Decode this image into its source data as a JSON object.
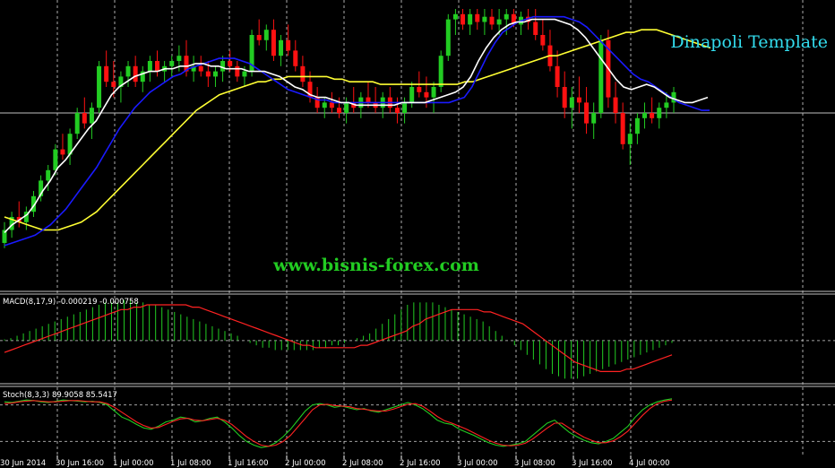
{
  "chart_data": {
    "type": "candlestick",
    "title": "Dinapoli Template",
    "watermark": "www.bisnis-forex.com",
    "colors": {
      "background": "#000000",
      "bull": "#22cc22",
      "bear": "#ff1111",
      "ma_white": "#ffffff",
      "ma_blue": "#1a1aff",
      "ma_yellow": "#ffff33",
      "macd_hist": "#22cc22",
      "macd_signal": "#ff2222",
      "stoch_main": "#22cc22",
      "stoch_signal": "#ff2222",
      "title": "#33ddee",
      "watermark": "#22cc22",
      "grid": "#cccccc"
    },
    "x_ticks": [
      "30 Jun 2014",
      "30 Jun 16:00",
      "1 Jul 00:00",
      "1 Jul 08:00",
      "1 Jul 16:00",
      "2 Jul 00:00",
      "2 Jul 08:00",
      "2 Jul 16:00",
      "3 Jul 00:00",
      "3 Jul 08:00",
      "3 Jul 16:00",
      "4 Jul 00:00"
    ],
    "price_range": [
      0,
      100
    ],
    "candles": [
      [
        10,
        18,
        8,
        15
      ],
      [
        15,
        22,
        12,
        20
      ],
      [
        20,
        26,
        16,
        18
      ],
      [
        18,
        24,
        15,
        22
      ],
      [
        22,
        30,
        20,
        28
      ],
      [
        28,
        36,
        26,
        34
      ],
      [
        34,
        40,
        30,
        38
      ],
      [
        38,
        48,
        36,
        46
      ],
      [
        46,
        52,
        42,
        44
      ],
      [
        44,
        54,
        40,
        52
      ],
      [
        52,
        62,
        50,
        60
      ],
      [
        60,
        66,
        54,
        56
      ],
      [
        56,
        64,
        50,
        62
      ],
      [
        62,
        80,
        60,
        78
      ],
      [
        78,
        84,
        70,
        72
      ],
      [
        72,
        80,
        66,
        70
      ],
      [
        70,
        76,
        64,
        74
      ],
      [
        74,
        80,
        70,
        78
      ],
      [
        78,
        82,
        70,
        72
      ],
      [
        72,
        78,
        68,
        76
      ],
      [
        76,
        82,
        72,
        80
      ],
      [
        80,
        84,
        74,
        76
      ],
      [
        76,
        80,
        72,
        78
      ],
      [
        78,
        82,
        74,
        80
      ],
      [
        80,
        86,
        76,
        82
      ],
      [
        82,
        88,
        74,
        76
      ],
      [
        76,
        82,
        72,
        78
      ],
      [
        78,
        82,
        74,
        76
      ],
      [
        76,
        80,
        70,
        74
      ],
      [
        74,
        78,
        70,
        76
      ],
      [
        76,
        82,
        72,
        80
      ],
      [
        80,
        84,
        76,
        78
      ],
      [
        78,
        80,
        72,
        74
      ],
      [
        74,
        78,
        70,
        76
      ],
      [
        76,
        92,
        74,
        90
      ],
      [
        90,
        96,
        86,
        88
      ],
      [
        88,
        94,
        84,
        92
      ],
      [
        92,
        96,
        80,
        82
      ],
      [
        82,
        90,
        78,
        88
      ],
      [
        88,
        94,
        82,
        84
      ],
      [
        84,
        88,
        76,
        78
      ],
      [
        78,
        82,
        70,
        72
      ],
      [
        72,
        76,
        64,
        66
      ],
      [
        66,
        70,
        60,
        62
      ],
      [
        62,
        66,
        58,
        64
      ],
      [
        64,
        68,
        60,
        62
      ],
      [
        62,
        66,
        58,
        60
      ],
      [
        60,
        66,
        56,
        64
      ],
      [
        64,
        70,
        60,
        62
      ],
      [
        62,
        68,
        58,
        66
      ],
      [
        66,
        72,
        62,
        64
      ],
      [
        64,
        70,
        60,
        62
      ],
      [
        62,
        68,
        58,
        66
      ],
      [
        66,
        70,
        60,
        62
      ],
      [
        62,
        66,
        56,
        60
      ],
      [
        60,
        66,
        56,
        64
      ],
      [
        64,
        72,
        62,
        70
      ],
      [
        70,
        76,
        66,
        68
      ],
      [
        68,
        74,
        62,
        66
      ],
      [
        66,
        72,
        60,
        70
      ],
      [
        70,
        84,
        68,
        82
      ],
      [
        82,
        98,
        80,
        96
      ],
      [
        96,
        100,
        90,
        98
      ],
      [
        98,
        100,
        92,
        94
      ],
      [
        94,
        100,
        90,
        98
      ],
      [
        98,
        100,
        92,
        95
      ],
      [
        95,
        100,
        90,
        97
      ],
      [
        97,
        100,
        92,
        94
      ],
      [
        94,
        100,
        90,
        96
      ],
      [
        96,
        100,
        90,
        98
      ],
      [
        98,
        100,
        93,
        94
      ],
      [
        94,
        99,
        90,
        97
      ],
      [
        97,
        100,
        92,
        95
      ],
      [
        95,
        100,
        88,
        90
      ],
      [
        90,
        96,
        84,
        86
      ],
      [
        86,
        92,
        76,
        78
      ],
      [
        78,
        84,
        66,
        70
      ],
      [
        70,
        76,
        58,
        62
      ],
      [
        62,
        70,
        54,
        66
      ],
      [
        66,
        74,
        60,
        64
      ],
      [
        64,
        70,
        52,
        56
      ],
      [
        56,
        64,
        50,
        60
      ],
      [
        60,
        90,
        58,
        88
      ],
      [
        88,
        92,
        62,
        66
      ],
      [
        66,
        72,
        56,
        60
      ],
      [
        60,
        64,
        46,
        48
      ],
      [
        48,
        56,
        40,
        52
      ],
      [
        52,
        60,
        48,
        58
      ],
      [
        58,
        64,
        54,
        60
      ],
      [
        60,
        66,
        56,
        58
      ],
      [
        58,
        64,
        54,
        62
      ],
      [
        62,
        68,
        58,
        64
      ],
      [
        64,
        70,
        60,
        68
      ]
    ],
    "ma_white": [
      14,
      17,
      19,
      21,
      25,
      30,
      34,
      39,
      42,
      46,
      50,
      54,
      57,
      62,
      67,
      70,
      72,
      74,
      75,
      76,
      76,
      77,
      77,
      78,
      78,
      79,
      79,
      78,
      78,
      77,
      77,
      77,
      76,
      76,
      76,
      75,
      74,
      72,
      70,
      69,
      67,
      66,
      66,
      65,
      64,
      64,
      63,
      63,
      63,
      63,
      63,
      63,
      64,
      64,
      64,
      64,
      65,
      66,
      67,
      68,
      70,
      74,
      80,
      85,
      89,
      92,
      94,
      95,
      95,
      96,
      96,
      96,
      96,
      95,
      94,
      92,
      89,
      85,
      81,
      77,
      73,
      70,
      69,
      70,
      71,
      70,
      68,
      66,
      65,
      64,
      64,
      65,
      66
    ],
    "ma_blue": [
      9,
      10,
      11,
      12,
      13,
      15,
      17,
      20,
      23,
      27,
      31,
      35,
      39,
      44,
      49,
      54,
      58,
      62,
      65,
      68,
      70,
      72,
      74,
      75,
      77,
      78,
      79,
      80,
      81,
      81,
      81,
      80,
      79,
      77,
      75,
      73,
      71,
      69,
      68,
      67,
      66,
      65,
      65,
      64,
      64,
      64,
      64,
      64,
      64,
      64,
      64,
      64,
      64,
      64,
      64,
      64,
      64,
      64,
      64,
      65,
      66,
      70,
      76,
      82,
      87,
      91,
      93,
      95,
      96,
      97,
      97,
      97,
      97,
      97,
      96,
      95,
      93,
      90,
      87,
      84,
      81,
      78,
      75,
      73,
      72,
      70,
      68,
      66,
      64,
      63,
      62,
      61,
      61
    ],
    "ma_yellow": [
      20,
      19,
      18,
      17,
      16,
      15,
      15,
      15,
      16,
      17,
      18,
      20,
      22,
      25,
      28,
      31,
      34,
      37,
      40,
      43,
      46,
      49,
      52,
      55,
      58,
      61,
      63,
      65,
      67,
      68,
      69,
      70,
      71,
      72,
      72,
      73,
      73,
      74,
      74,
      74,
      74,
      74,
      74,
      73,
      73,
      72,
      72,
      72,
      72,
      71,
      71,
      71,
      71,
      71,
      71,
      71,
      71,
      71,
      71,
      71,
      72,
      72,
      73,
      74,
      75,
      76,
      77,
      78,
      79,
      80,
      81,
      82,
      82,
      83,
      84,
      85,
      86,
      87,
      88,
      89,
      90,
      91,
      91,
      92,
      92,
      92,
      91,
      90,
      89,
      88,
      87,
      86,
      85
    ],
    "macd": {
      "label": "MACD(8,17,9) -0.000219 -0.000758",
      "histogram": [
        0.5,
        1,
        2,
        3,
        4,
        5,
        6,
        7,
        8,
        9,
        10,
        11,
        12,
        13,
        14,
        15,
        16,
        16,
        16,
        17,
        17,
        16,
        16,
        15,
        15,
        14,
        13,
        12,
        11,
        10,
        9,
        8,
        7,
        6,
        5,
        4,
        3,
        2,
        0,
        -1,
        -2,
        -3,
        -3,
        -4,
        -4,
        -4,
        -4,
        -4,
        -4,
        -4,
        -3,
        -3,
        -2,
        -2,
        -1,
        0,
        1,
        2,
        3,
        5,
        7,
        9,
        11,
        13,
        15,
        16,
        16,
        16,
        16,
        15,
        14,
        13,
        12,
        11,
        10,
        9,
        8,
        6,
        4,
        2,
        0,
        -2,
        -4,
        -6,
        -8,
        -10,
        -12,
        -14,
        -15,
        -16,
        -16,
        -16,
        -15,
        -14,
        -13,
        -12,
        -11,
        -10,
        -9,
        -8,
        -7,
        -6,
        -5,
        -4,
        -3,
        -2,
        -1
      ],
      "signal": [
        -5,
        -4,
        -3,
        -2,
        -1,
        0,
        1,
        2,
        3,
        4,
        5,
        6,
        7,
        8,
        9,
        10,
        11,
        12,
        13,
        13,
        14,
        14,
        15,
        15,
        15,
        15,
        15,
        15,
        15,
        14,
        14,
        13,
        12,
        11,
        10,
        9,
        8,
        7,
        6,
        5,
        4,
        3,
        2,
        1,
        0,
        -1,
        -2,
        -2,
        -3,
        -3,
        -3,
        -3,
        -3,
        -3,
        -3,
        -2,
        -2,
        -1,
        0,
        1,
        2,
        3,
        4,
        6,
        7,
        9,
        10,
        11,
        12,
        13,
        13,
        13,
        13,
        13,
        12,
        12,
        11,
        10,
        9,
        8,
        7,
        5,
        3,
        1,
        -1,
        -3,
        -5,
        -7,
        -9,
        -10,
        -11,
        -12,
        -13,
        -13,
        -13,
        -13,
        -12,
        -12,
        -11,
        -10,
        -9,
        -8,
        -7,
        -6
      ],
      "range": [
        -17,
        18
      ]
    },
    "stoch": {
      "label": "Stoch(8,3,3) 89.9058 85.5417",
      "levels": [
        80,
        20
      ],
      "main": [
        85,
        84,
        86,
        88,
        87,
        85,
        84,
        86,
        88,
        87,
        86,
        85,
        86,
        84,
        80,
        70,
        60,
        55,
        48,
        42,
        40,
        45,
        52,
        55,
        60,
        58,
        52,
        54,
        58,
        60,
        52,
        42,
        30,
        20,
        14,
        10,
        12,
        18,
        28,
        40,
        55,
        70,
        80,
        82,
        80,
        76,
        78,
        75,
        72,
        74,
        70,
        68,
        72,
        76,
        80,
        84,
        80,
        74,
        65,
        55,
        50,
        48,
        40,
        35,
        30,
        24,
        18,
        14,
        12,
        14,
        16,
        20,
        30,
        40,
        50,
        55,
        45,
        35,
        28,
        22,
        18,
        16,
        20,
        25,
        35,
        45,
        60,
        72,
        80,
        85,
        88,
        90
      ],
      "signal": [
        82,
        83,
        85,
        86,
        87,
        86,
        85,
        85,
        86,
        87,
        87,
        86,
        85,
        85,
        82,
        76,
        68,
        60,
        52,
        46,
        42,
        43,
        48,
        53,
        57,
        58,
        55,
        54,
        56,
        58,
        55,
        48,
        38,
        28,
        20,
        14,
        12,
        14,
        20,
        30,
        44,
        58,
        72,
        80,
        81,
        79,
        78,
        77,
        74,
        73,
        71,
        70,
        70,
        73,
        77,
        81,
        82,
        78,
        70,
        61,
        54,
        50,
        45,
        40,
        34,
        28,
        22,
        17,
        14,
        13,
        14,
        17,
        24,
        33,
        42,
        50,
        50,
        42,
        34,
        27,
        22,
        18,
        18,
        21,
        28,
        37,
        50,
        63,
        74,
        82,
        86,
        88
      ]
    }
  }
}
